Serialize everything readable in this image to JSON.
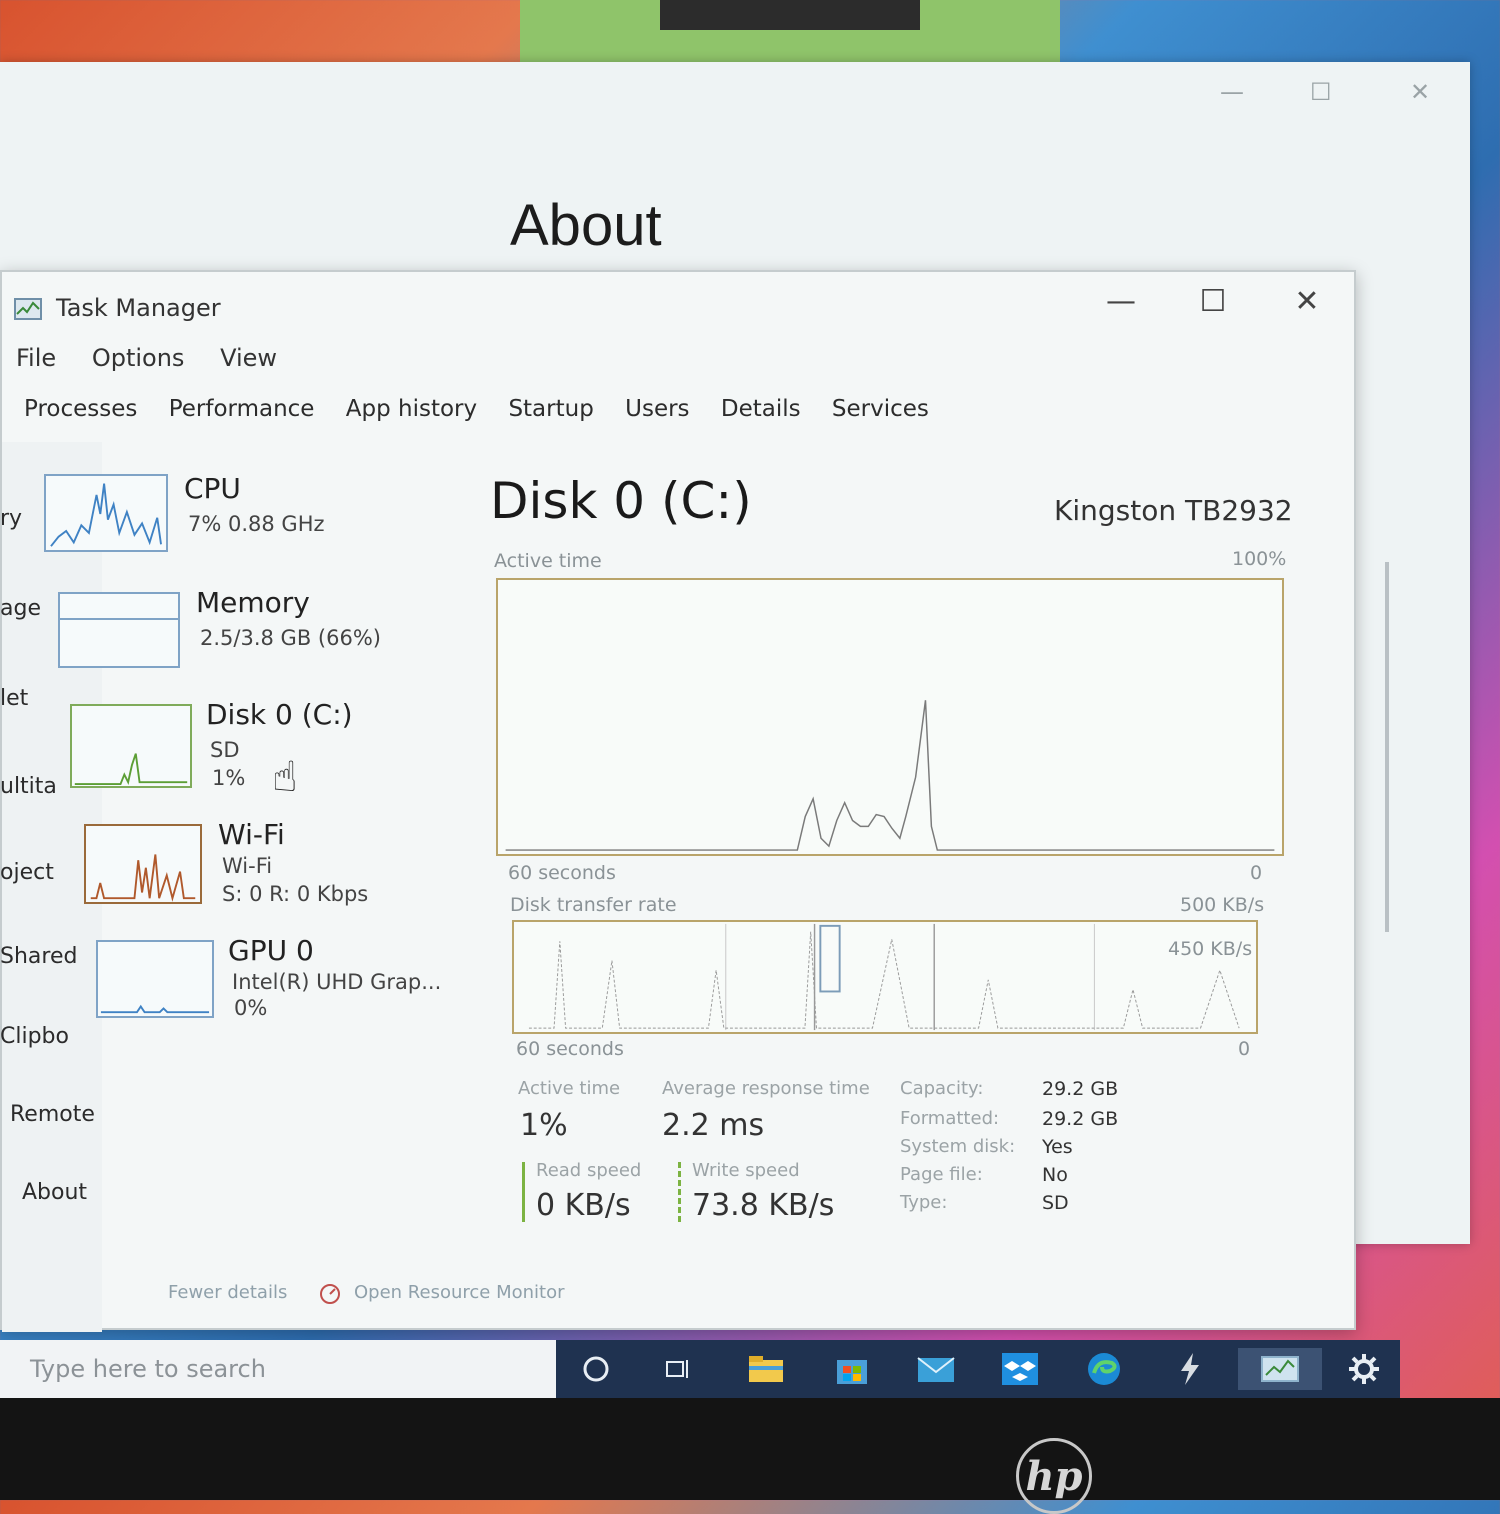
{
  "settings": {
    "title": "About",
    "nav": [
      "ry",
      "age",
      "let",
      "ultita",
      "oject",
      "Shared",
      "Clipbo",
      "Remote",
      "About"
    ],
    "controls": {
      "minimize": "—",
      "maximize": "☐",
      "close": "✕"
    }
  },
  "task_manager": {
    "title": "Task Manager",
    "controls": {
      "minimize": "—",
      "maximize": "☐",
      "close": "✕"
    },
    "menu": [
      "File",
      "Options",
      "View"
    ],
    "tabs": [
      "Processes",
      "Performance",
      "App history",
      "Startup",
      "Users",
      "Details",
      "Services"
    ],
    "resources": {
      "cpu": {
        "name": "CPU",
        "sub1": "7% 0.88 GHz"
      },
      "memory": {
        "name": "Memory",
        "sub1": "2.5/3.8 GB (66%)"
      },
      "disk": {
        "name": "Disk 0 (C:)",
        "sub1": "SD",
        "sub2": "1%"
      },
      "wifi": {
        "name": "Wi-Fi",
        "sub1": "Wi-Fi",
        "sub2": "S: 0 R: 0 Kbps"
      },
      "gpu": {
        "name": "GPU 0",
        "sub1": "Intel(R) UHD Grap...",
        "sub2": "0%"
      }
    },
    "detail": {
      "title": "Disk 0 (C:)",
      "model": "Kingston TB2932",
      "active_time_label": "Active time",
      "active_time_max": "100%",
      "sixty_seconds": "60 seconds",
      "zero": "0",
      "transfer_label": "Disk transfer rate",
      "transfer_max": "500 KB/s",
      "transfer_mark": "450 KB/s",
      "stats": {
        "active_time_label": "Active time",
        "active_time_value": "1%",
        "avg_resp_label": "Average response time",
        "avg_resp_value": "2.2 ms",
        "read_label": "Read speed",
        "read_value": "0 KB/s",
        "write_label": "Write speed",
        "write_value": "73.8 KB/s"
      },
      "props": [
        {
          "label": "Capacity:",
          "value": "29.2 GB"
        },
        {
          "label": "Formatted:",
          "value": "29.2 GB"
        },
        {
          "label": "System disk:",
          "value": "Yes"
        },
        {
          "label": "Page file:",
          "value": "No"
        },
        {
          "label": "Type:",
          "value": "SD"
        }
      ]
    },
    "footer": {
      "fewer": "Fewer details",
      "monitor": "Open Resource Monitor"
    }
  },
  "taskbar": {
    "search_placeholder": "Type here to search",
    "icons": [
      "cortana-icon",
      "task-view-icon",
      "file-explorer-icon",
      "store-icon",
      "mail-icon",
      "dropbox-icon",
      "edge-icon",
      "app-icon",
      "task-manager-icon",
      "settings-icon"
    ]
  },
  "bezel": {
    "logo": "hp"
  }
}
